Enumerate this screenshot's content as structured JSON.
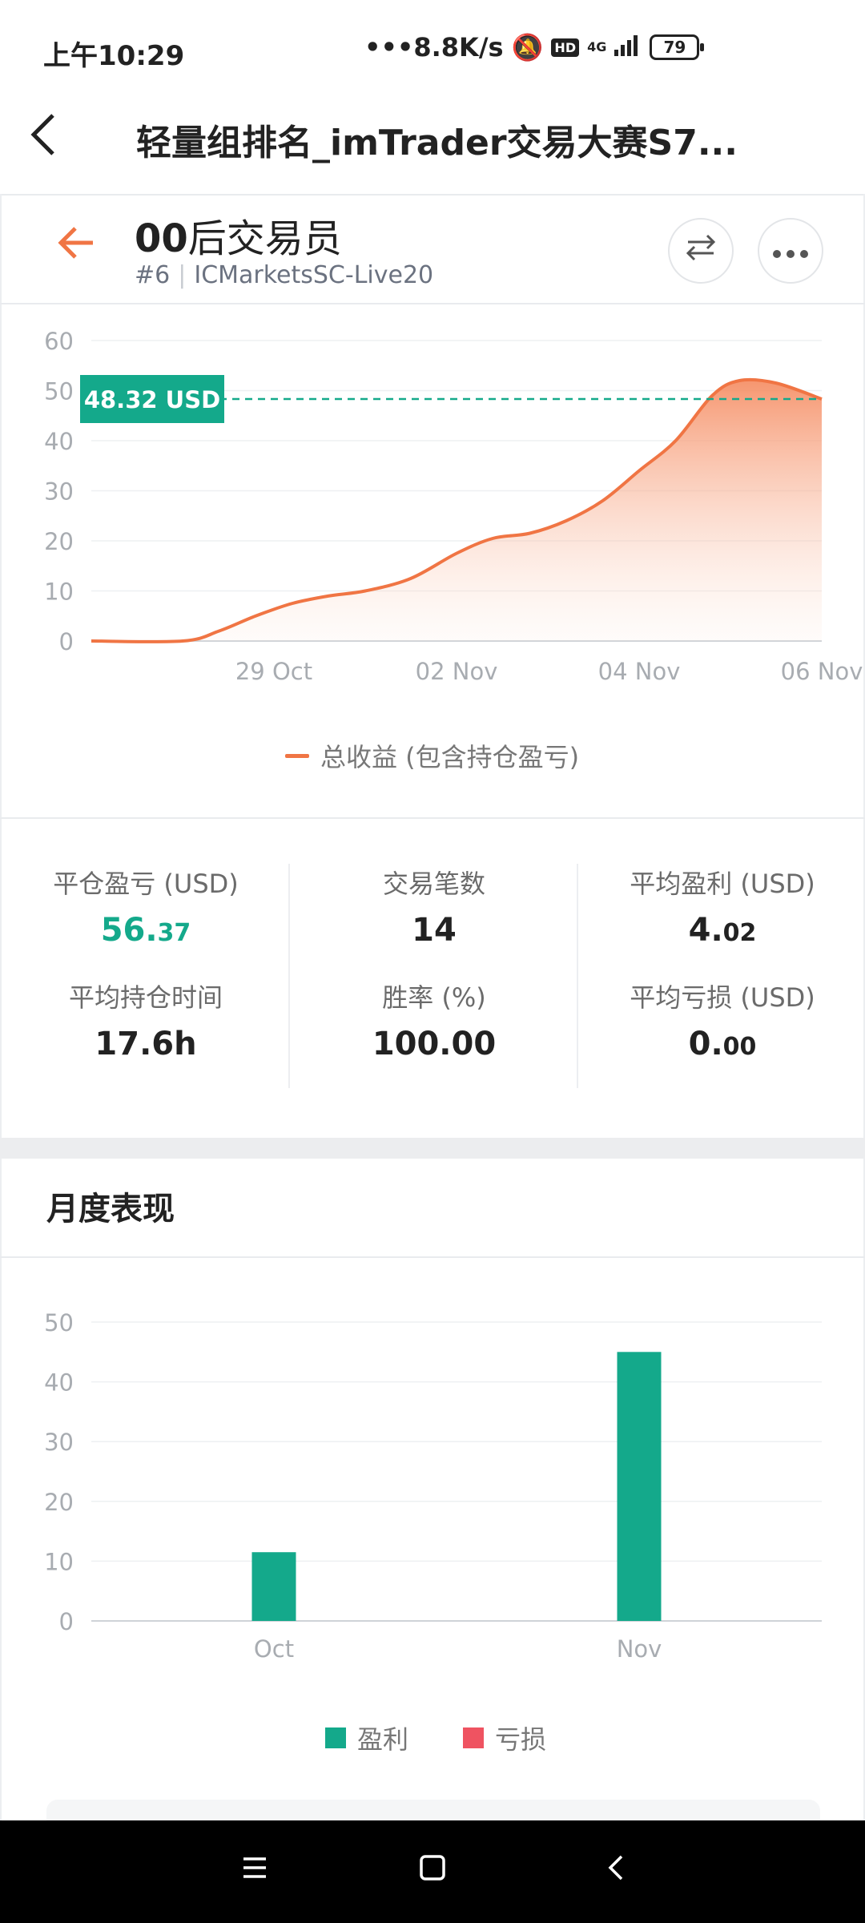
{
  "status_bar": {
    "time": "上午10:29",
    "network_speed": "•••8.8K/s",
    "hd": "HD",
    "signal": "4G",
    "battery": "79"
  },
  "header": {
    "title": "轻量组排名_imTrader交易大赛S7..."
  },
  "trader": {
    "name_prefix": "00",
    "name_suffix": "后交易员",
    "rank": "#6",
    "server": "ICMarketsSC-Live20"
  },
  "equity_chart": {
    "current_label": "48.32 USD",
    "legend": "总收益 (包含持仓盈亏)"
  },
  "stats": {
    "closed_pnl_label": "平仓盈亏 (USD)",
    "closed_pnl_int": "56.",
    "closed_pnl_dec": "37",
    "trades_label": "交易笔数",
    "trades_value": "14",
    "avg_profit_label": "平均盈利 (USD)",
    "avg_profit_int": "4.",
    "avg_profit_dec": "02",
    "avg_hold_label": "平均持仓时间",
    "avg_hold_value": "17.6h",
    "win_rate_label": "胜率 (%)",
    "win_rate_value": "100.00",
    "avg_loss_label": "平均亏损 (USD)",
    "avg_loss_int": "0.",
    "avg_loss_dec": "00"
  },
  "monthly": {
    "title": "月度表现",
    "legend_profit": "盈利",
    "legend_loss": "亏损"
  },
  "colors": {
    "accent_orange": "#f07544",
    "profit_green": "#14a98b",
    "loss_red": "#ef5361"
  },
  "chart_data": [
    {
      "type": "area",
      "legend": "总收益 (包含持仓盈亏)",
      "ylim": [
        0,
        60
      ],
      "y_ticks": [
        "0",
        "10",
        "20",
        "30",
        "40",
        "50",
        "60"
      ],
      "x_tick_labels": [
        "29 Oct",
        "02 Nov",
        "04 Nov",
        "06 Nov"
      ],
      "x_tick_positions": [
        2,
        4,
        6,
        8
      ],
      "xlim": [
        0,
        8
      ],
      "points": [
        {
          "x": 0.0,
          "y": 0
        },
        {
          "x": 1.0,
          "y": 0
        },
        {
          "x": 1.4,
          "y": 2
        },
        {
          "x": 1.8,
          "y": 5
        },
        {
          "x": 2.2,
          "y": 7.5
        },
        {
          "x": 2.6,
          "y": 9
        },
        {
          "x": 3.0,
          "y": 10
        },
        {
          "x": 3.5,
          "y": 12.5
        },
        {
          "x": 4.0,
          "y": 17.5
        },
        {
          "x": 4.4,
          "y": 20.5
        },
        {
          "x": 4.8,
          "y": 21.5
        },
        {
          "x": 5.2,
          "y": 24
        },
        {
          "x": 5.6,
          "y": 28
        },
        {
          "x": 6.0,
          "y": 34
        },
        {
          "x": 6.4,
          "y": 40
        },
        {
          "x": 6.8,
          "y": 49
        },
        {
          "x": 7.1,
          "y": 52
        },
        {
          "x": 7.5,
          "y": 51.5
        },
        {
          "x": 8.0,
          "y": 48.32
        }
      ],
      "reference_line": 48.32
    },
    {
      "type": "bar",
      "categories": [
        "Oct",
        "Nov"
      ],
      "series": [
        {
          "name": "盈利",
          "values": [
            11.5,
            45
          ]
        },
        {
          "name": "亏损",
          "values": [
            0,
            0
          ]
        }
      ],
      "ylim": [
        0,
        50
      ],
      "y_ticks": [
        "0",
        "10",
        "20",
        "30",
        "40",
        "50"
      ]
    }
  ]
}
